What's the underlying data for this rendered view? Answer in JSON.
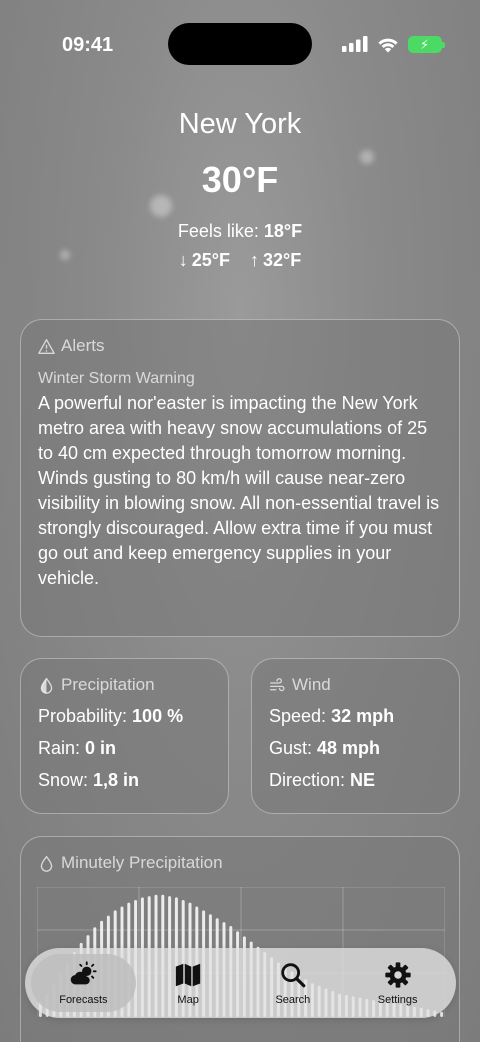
{
  "status_bar": {
    "time": "09:41"
  },
  "header": {
    "city": "New York",
    "temperature": "30°F",
    "feels_like_label": "Feels like: ",
    "feels_like_value": "18°F",
    "low": "25°F",
    "high": "32°F"
  },
  "alerts": {
    "title": "Alerts",
    "warning_title": "Winter Storm Warning",
    "warning_text": "A powerful nor'easter is impacting the New York metro area with heavy snow accumulations of 25 to 40 cm expected through tomorrow morning. Winds gusting to 80 km/h will cause near-zero visibility in blowing snow. All non-essential travel is strongly discouraged. Allow extra time if you must go out and keep emergency supplies in your vehicle."
  },
  "precipitation": {
    "title": "Precipitation",
    "rows": [
      {
        "label": "Probability: ",
        "value": "100 %"
      },
      {
        "label": "Rain: ",
        "value": "0 in"
      },
      {
        "label": "Snow: ",
        "value": "1,8 in"
      }
    ]
  },
  "wind": {
    "title": "Wind",
    "rows": [
      {
        "label": "Speed: ",
        "value": "32 mph"
      },
      {
        "label": "Gust: ",
        "value": "48 mph"
      },
      {
        "label": "Direction: ",
        "value": "NE"
      }
    ]
  },
  "minutely": {
    "title": "Minutely Precipitation",
    "intensity": [
      0.12,
      0.18,
      0.26,
      0.34,
      0.42,
      0.5,
      0.57,
      0.63,
      0.69,
      0.74,
      0.78,
      0.82,
      0.85,
      0.88,
      0.9,
      0.92,
      0.93,
      0.94,
      0.94,
      0.93,
      0.92,
      0.9,
      0.88,
      0.85,
      0.82,
      0.79,
      0.76,
      0.73,
      0.7,
      0.66,
      0.62,
      0.58,
      0.54,
      0.5,
      0.46,
      0.42,
      0.38,
      0.35,
      0.32,
      0.29,
      0.26,
      0.24,
      0.22,
      0.2,
      0.18,
      0.17,
      0.16,
      0.15,
      0.14,
      0.13,
      0.12,
      0.12,
      0.11,
      0.1,
      0.09,
      0.08,
      0.07,
      0.06,
      0.05,
      0.04
    ]
  },
  "tabs": [
    {
      "label": "Forecasts",
      "icon": "cloud-sun-icon",
      "active": true
    },
    {
      "label": "Map",
      "icon": "map-icon",
      "active": false
    },
    {
      "label": "Search",
      "icon": "search-icon",
      "active": false
    },
    {
      "label": "Settings",
      "icon": "gear-icon",
      "active": false
    }
  ]
}
